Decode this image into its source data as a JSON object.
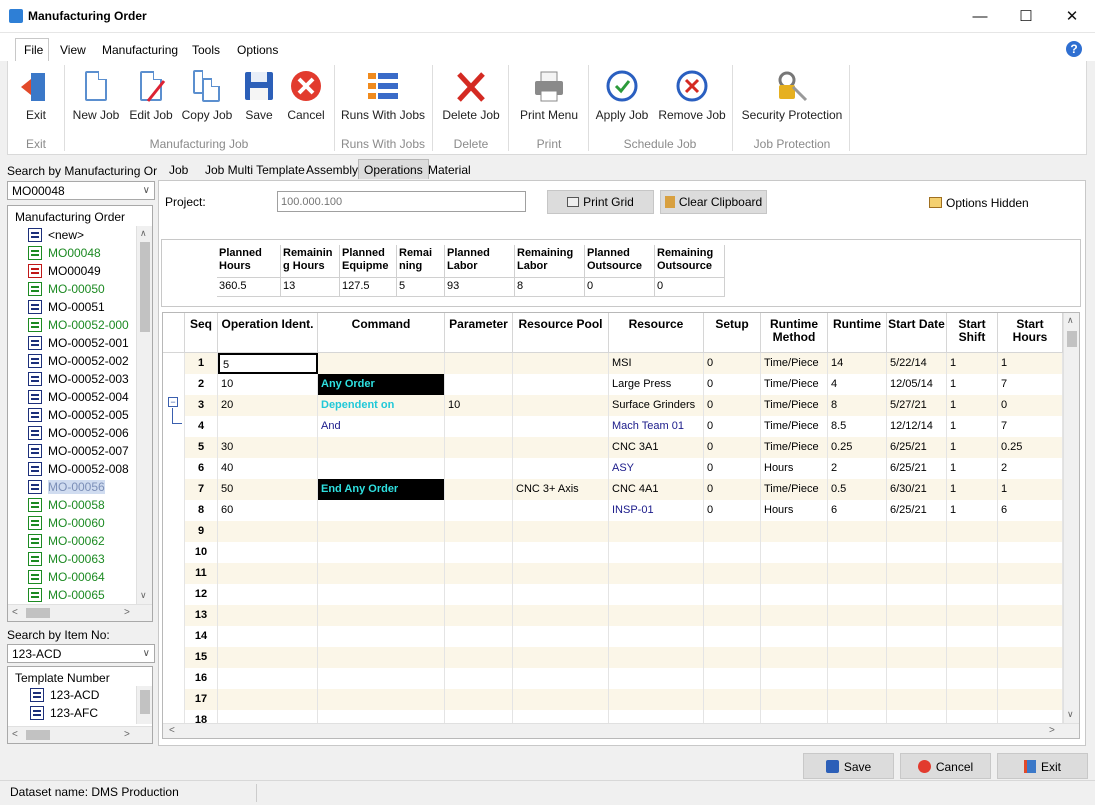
{
  "window": {
    "title": "Manufacturing Order"
  },
  "menu": {
    "file": "File",
    "view": "View",
    "manufacturing": "Manufacturing",
    "tools": "Tools",
    "options": "Options"
  },
  "ribbon": {
    "exit": "Exit",
    "new_job": "New Job",
    "edit_job": "Edit Job",
    "copy_job": "Copy Job",
    "save": "Save",
    "cancel": "Cancel",
    "runs_with_jobs": "Runs With Jobs",
    "delete_job": "Delete Job",
    "print_menu": "Print Menu",
    "apply_job": "Apply Job",
    "remove_job": "Remove Job",
    "security_protection": "Security Protection",
    "groups": {
      "exit": "Exit",
      "manufacturing_job": "Manufacturing Job",
      "runs_with_jobs": "Runs With Jobs",
      "delete": "Delete",
      "print": "Print",
      "schedule_job": "Schedule Job",
      "job_protection": "Job Protection"
    }
  },
  "left": {
    "search_mo_label": "Search by Manufacturing Orde",
    "search_mo_value": "MO00048",
    "tree_title": "Manufacturing Order",
    "tree_items": [
      {
        "label": "<new>",
        "color": "#000000"
      },
      {
        "label": "MO00048",
        "color": "#1c8a22"
      },
      {
        "label": "MO00049",
        "color": "#000000"
      },
      {
        "label": "MO-00050",
        "color": "#1c8a22"
      },
      {
        "label": "MO-00051",
        "color": "#000000"
      },
      {
        "label": "MO-00052-000",
        "color": "#1c8a22"
      },
      {
        "label": "MO-00052-001",
        "color": "#000000"
      },
      {
        "label": "MO-00052-002",
        "color": "#000000"
      },
      {
        "label": "MO-00052-003",
        "color": "#000000"
      },
      {
        "label": "MO-00052-004",
        "color": "#000000"
      },
      {
        "label": "MO-00052-005",
        "color": "#000000"
      },
      {
        "label": "MO-00052-006",
        "color": "#000000"
      },
      {
        "label": "MO-00052-007",
        "color": "#000000"
      },
      {
        "label": "MO-00052-008",
        "color": "#000000"
      },
      {
        "label": "MO-00056",
        "color": "#7c8fb8"
      },
      {
        "label": "MO-00058",
        "color": "#1c8a22"
      },
      {
        "label": "MO-00060",
        "color": "#1c8a22"
      },
      {
        "label": "MO-00062",
        "color": "#1c8a22"
      },
      {
        "label": "MO-00063",
        "color": "#1c8a22"
      },
      {
        "label": "MO-00064",
        "color": "#1c8a22"
      },
      {
        "label": "MO-00065",
        "color": "#1c8a22"
      }
    ],
    "search_item_label": "Search by Item No:",
    "search_item_value": "123-ACD",
    "template_title": "Template Number",
    "template_items": [
      "123-ACD",
      "123-AFC"
    ]
  },
  "tabs": {
    "job": "Job",
    "job_multi_template": "Job Multi Template",
    "assembly": "Assembly",
    "operations": "Operations",
    "material": "Material"
  },
  "toolbar": {
    "project_label": "Project:",
    "project_placeholder": "100.000.100",
    "print_grid": "Print Grid",
    "clear_clipboard": "Clear Clipboard",
    "options_hidden": "Options Hidden"
  },
  "summary": {
    "headers": [
      "Planned Hours",
      "Remainin g Hours",
      "Planned Equipme",
      "Remai ning",
      "Planned Labor",
      "Remaining Labor",
      "Planned Outsource",
      "Remaining Outsource"
    ],
    "values": [
      "360.5",
      "13",
      "127.5",
      "5",
      "93",
      "8",
      "0",
      "0"
    ]
  },
  "grid": {
    "headers": [
      "Seq",
      "Operation Ident.",
      "Command",
      "Parameter",
      "Resource Pool",
      "Resource",
      "Setup",
      "Runtime Method",
      "Runtime",
      "Start Date",
      "Start Shift",
      "Start Hours"
    ],
    "rows": [
      [
        "1",
        "5",
        "",
        "",
        "",
        "MSI",
        "0",
        "Time/Piece",
        "14",
        "5/22/14",
        "1",
        "1"
      ],
      [
        "2",
        "10",
        "Any Order",
        "",
        "",
        "Large Press",
        "0",
        "Time/Piece",
        "4",
        "12/05/14",
        "1",
        "7"
      ],
      [
        "3",
        "20",
        "Dependent on",
        "10",
        "",
        "Surface Grinders",
        "0",
        "Time/Piece",
        "8",
        "5/27/21",
        "1",
        "0"
      ],
      [
        "4",
        "",
        "And",
        "",
        "",
        "Mach Team 01",
        "0",
        "Time/Piece",
        "8.5",
        "12/12/14",
        "1",
        "7"
      ],
      [
        "5",
        "30",
        "",
        "",
        "",
        "CNC 3A1",
        "0",
        "Time/Piece",
        "0.25",
        "6/25/21",
        "1",
        "0.25"
      ],
      [
        "6",
        "40",
        "",
        "",
        "",
        "ASY",
        "0",
        "Hours",
        "2",
        "6/25/21",
        "1",
        "2"
      ],
      [
        "7",
        "50",
        "End Any Order",
        "",
        "CNC 3+ Axis",
        "CNC 4A1",
        "0",
        "Time/Piece",
        "0.5",
        "6/30/21",
        "1",
        "1"
      ],
      [
        "8",
        "60",
        "",
        "",
        "",
        "INSP-01",
        "0",
        "Hours",
        "6",
        "6/25/21",
        "1",
        "6"
      ],
      [
        "9",
        "",
        "",
        "",
        "",
        "",
        "",
        "",
        "",
        "",
        "",
        ""
      ],
      [
        "10",
        "",
        "",
        "",
        "",
        "",
        "",
        "",
        "",
        "",
        "",
        ""
      ],
      [
        "11",
        "",
        "",
        "",
        "",
        "",
        "",
        "",
        "",
        "",
        "",
        ""
      ],
      [
        "12",
        "",
        "",
        "",
        "",
        "",
        "",
        "",
        "",
        "",
        "",
        ""
      ],
      [
        "13",
        "",
        "",
        "",
        "",
        "",
        "",
        "",
        "",
        "",
        "",
        ""
      ],
      [
        "14",
        "",
        "",
        "",
        "",
        "",
        "",
        "",
        "",
        "",
        "",
        ""
      ],
      [
        "15",
        "",
        "",
        "",
        "",
        "",
        "",
        "",
        "",
        "",
        "",
        ""
      ],
      [
        "16",
        "",
        "",
        "",
        "",
        "",
        "",
        "",
        "",
        "",
        "",
        ""
      ],
      [
        "17",
        "",
        "",
        "",
        "",
        "",
        "",
        "",
        "",
        "",
        "",
        ""
      ],
      [
        "18",
        "",
        "",
        "",
        "",
        "",
        "",
        "",
        "",
        "",
        "",
        ""
      ]
    ]
  },
  "bottom": {
    "save": "Save",
    "cancel": "Cancel",
    "exit": "Exit"
  },
  "status": {
    "dataset": "Dataset name:  DMS Production"
  }
}
